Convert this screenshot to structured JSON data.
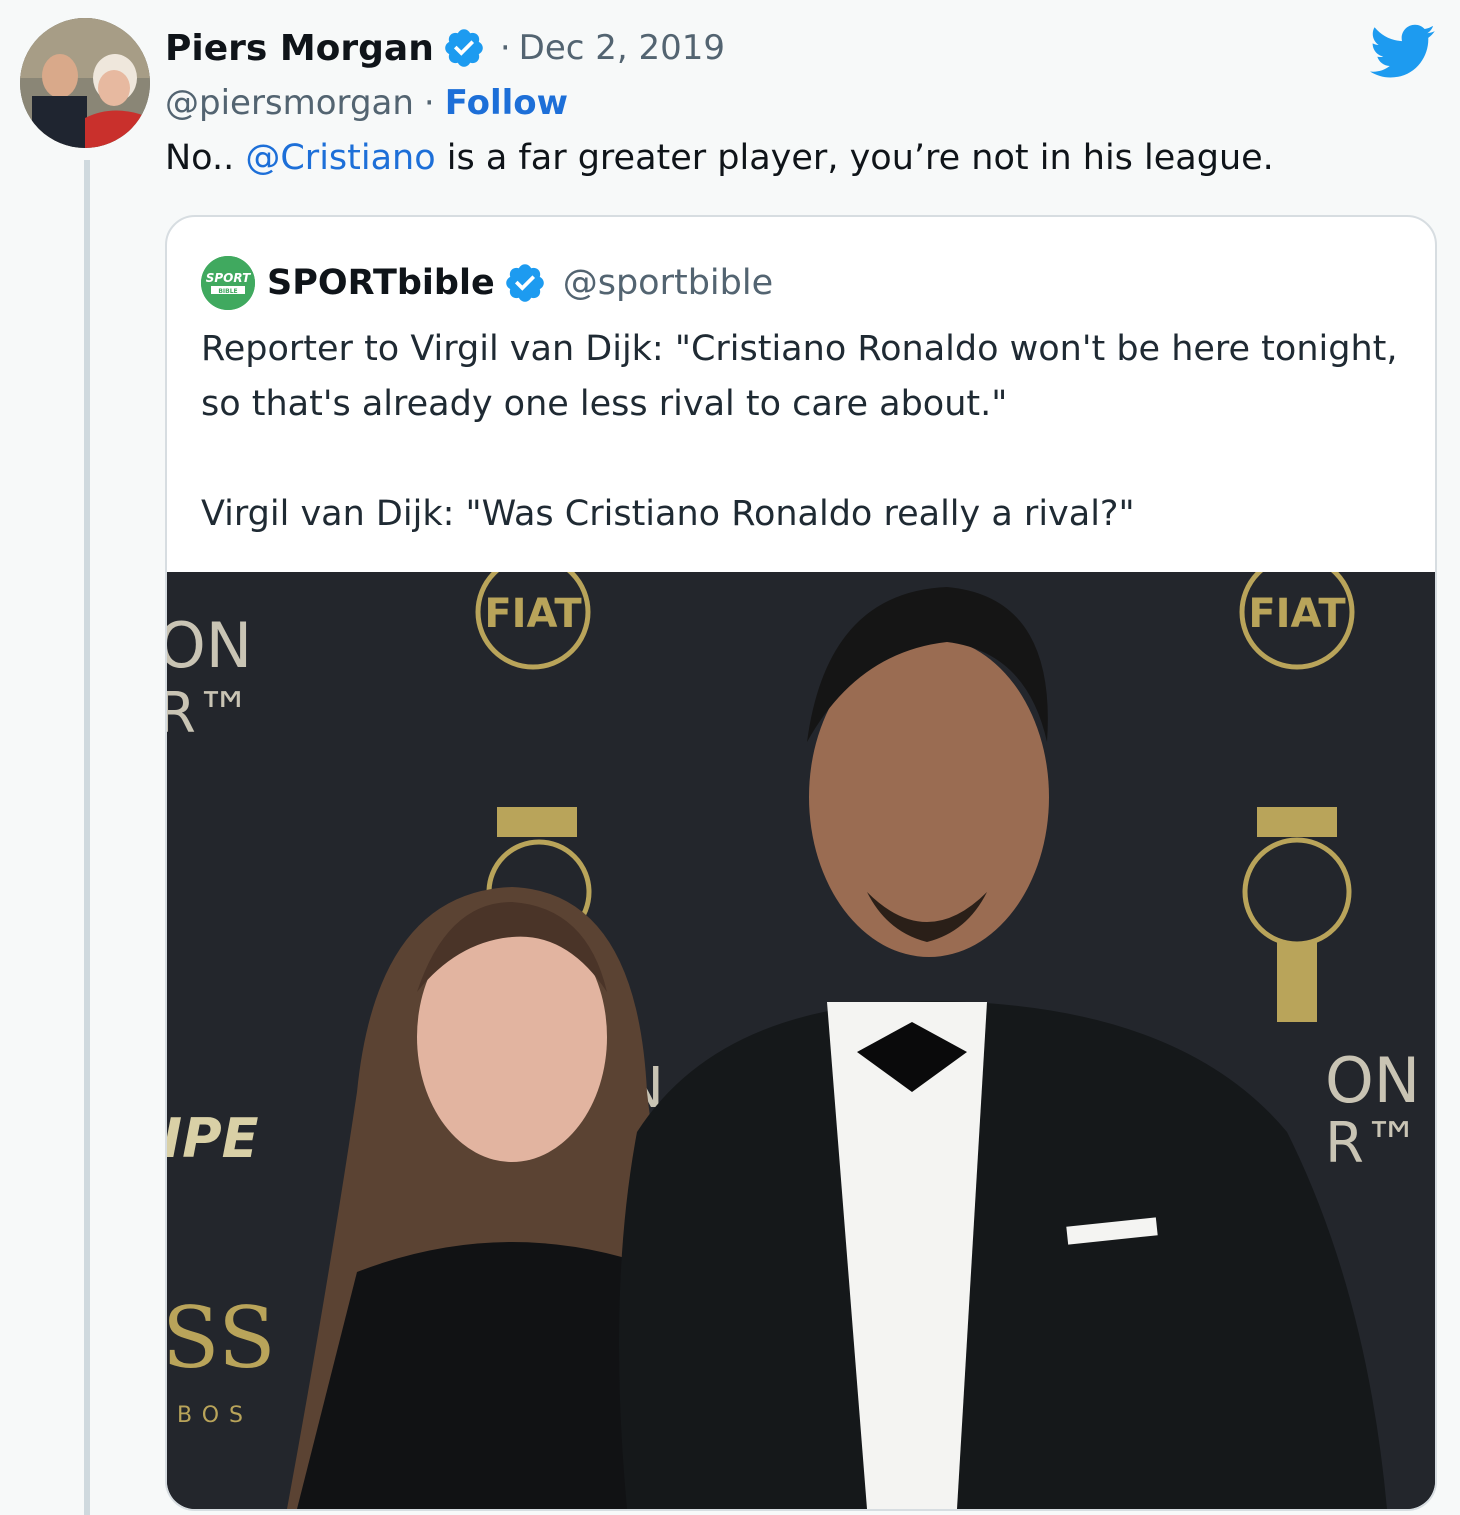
{
  "tweet": {
    "author": {
      "display_name": "Piers Morgan",
      "handle": "@piersmorgan",
      "verified_icon": "verified-badge-icon"
    },
    "separator": "·",
    "date": "Dec 2, 2019",
    "follow_label": "Follow",
    "text": {
      "prefix": "No.. ",
      "mention": "@Cristiano",
      "suffix": " is a far greater player, you’re not in his league."
    },
    "platform_icon": "twitter-bird-icon"
  },
  "quoted_tweet": {
    "author": {
      "display_name": "SPORTbible",
      "handle": "@sportbible",
      "avatar_text_top": "SPORT",
      "avatar_text_bottom": "BIBLE",
      "verified_icon": "verified-badge-icon"
    },
    "paragraphs": [
      "Reporter to Virgil van Dijk: \"Cristiano Ronaldo won't be here tonight, so that's already one less rival to care about.\"",
      "Virgil van Dijk: \"Was Cristiano Ronaldo really a rival?\""
    ],
    "photo": {
      "backdrop_texts": [
        "FIAT",
        "FIAT",
        "ON",
        "R™",
        "ON",
        "R™",
        "IPE",
        "SS",
        "BOS",
        "N"
      ]
    }
  },
  "colors": {
    "link": "#1d6fd8",
    "verified": "#1d9bf0",
    "twitter_blue": "#1d9bf0",
    "backdrop": "#23262c",
    "gold": "#b9a45a"
  }
}
